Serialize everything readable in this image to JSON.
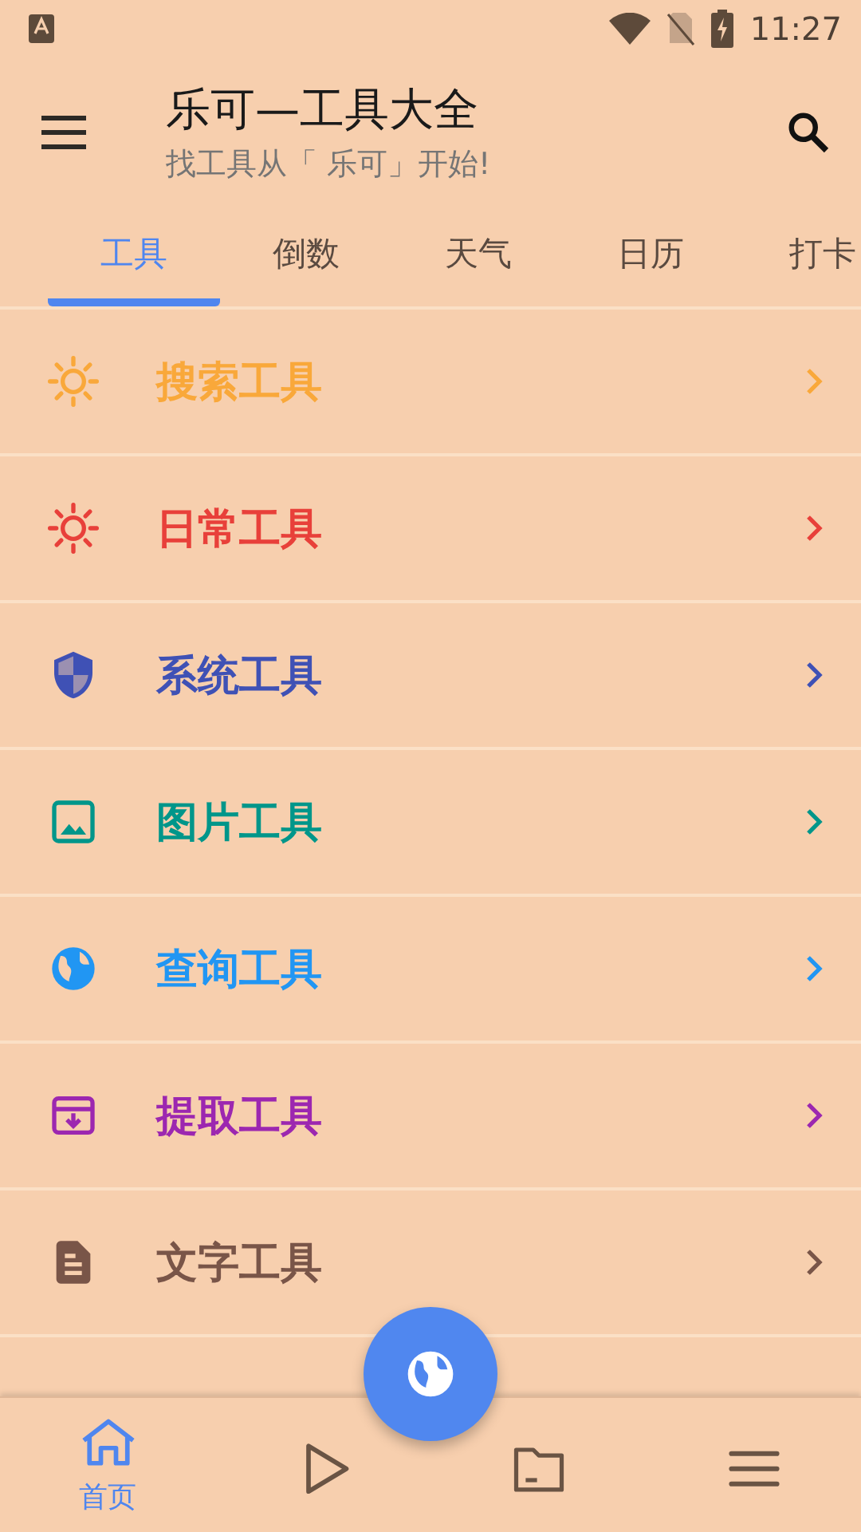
{
  "status_bar": {
    "time": "11:27"
  },
  "app_bar": {
    "title": "乐可—工具大全",
    "subtitle": "找工具从「 乐可」开始!"
  },
  "tabs": [
    {
      "label": "工具",
      "selected": true
    },
    {
      "label": "倒数",
      "selected": false
    },
    {
      "label": "天气",
      "selected": false
    },
    {
      "label": "日历",
      "selected": false
    },
    {
      "label": "打卡",
      "selected": false
    }
  ],
  "tool_list": [
    {
      "label": "搜索工具",
      "kind": "sun",
      "color": "#f9a83a"
    },
    {
      "label": "日常工具",
      "kind": "sun",
      "color": "#e8403a"
    },
    {
      "label": "系统工具",
      "kind": "shield",
      "color": "#3f51b5"
    },
    {
      "label": "图片工具",
      "kind": "image",
      "color": "#00968a"
    },
    {
      "label": "查询工具",
      "kind": "globe",
      "color": "#2196f3"
    },
    {
      "label": "提取工具",
      "kind": "archive",
      "color": "#9c27b0"
    },
    {
      "label": "文字工具",
      "kind": "document",
      "color": "#795548"
    }
  ],
  "bottom_nav": [
    {
      "kind": "home",
      "label": "首页",
      "selected": true
    },
    {
      "kind": "play",
      "selected": false
    },
    {
      "kind": "folder",
      "selected": false
    },
    {
      "kind": "menu",
      "selected": false
    }
  ]
}
